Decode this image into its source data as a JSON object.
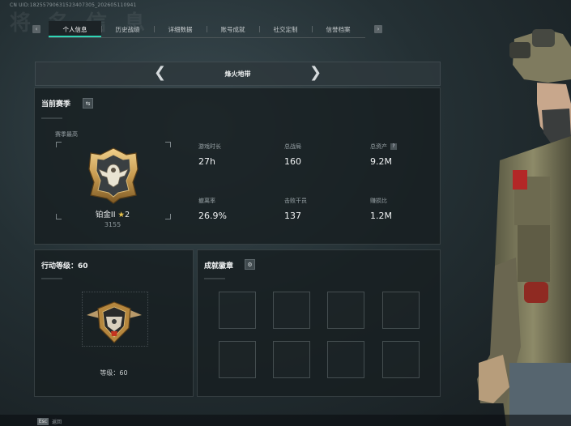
{
  "uid_line": "CN UID:18255790631523407305_202605110941",
  "ghost_title": "将 名 信 息",
  "tabs": [
    "个人信息",
    "历史战绩",
    "详细数据",
    "账号成就",
    "社交定制",
    "信誉档案"
  ],
  "active_tab_index": 0,
  "mode_title": "烽火地带",
  "season": {
    "title": "当前赛季",
    "rank_label": "赛季最高",
    "rank_name": "铂金II",
    "rank_stars": "2",
    "rank_score": "3155",
    "stats": [
      {
        "label": "游戏时长",
        "value": "27h"
      },
      {
        "label": "总战局",
        "value": "160"
      },
      {
        "label": "总资产",
        "value": "9.2M",
        "help": "?"
      },
      {
        "label": "撤离率",
        "value": "26.9%"
      },
      {
        "label": "击败干员",
        "value": "137"
      },
      {
        "label": "赚损比",
        "value": "1.2M"
      }
    ]
  },
  "action": {
    "title": "行动等级：60",
    "level_text": "等级：60"
  },
  "achievements": {
    "title": "成就徽章"
  },
  "footer": {
    "key": "Esc",
    "label": "返回"
  },
  "colors": {
    "accent": "#2fd5b5",
    "star": "#e7c24b",
    "badge_gold": "#c89b50"
  },
  "icons": {
    "tab_left": "chevron-left-icon",
    "tab_right": "chevron-right-icon",
    "swap": "swap-icon",
    "gear": "gear-icon"
  }
}
